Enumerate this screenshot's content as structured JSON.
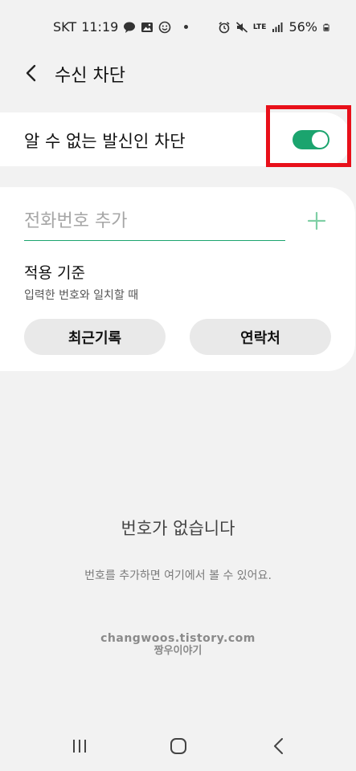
{
  "status_bar": {
    "carrier": "SKT",
    "time": "11:19",
    "network": "LTE",
    "battery": "56%"
  },
  "header": {
    "title": "수신 차단"
  },
  "master_switch": {
    "label": "알 수 없는 발신인 차단",
    "on": true
  },
  "add_number": {
    "placeholder": "전화번호 추가",
    "criteria_title": "적용 기준",
    "criteria_value": "입력한 번호와 일치할 때",
    "recent_button": "최근기록",
    "contacts_button": "연락처"
  },
  "empty_state": {
    "title": "번호가 없습니다",
    "subtitle": "번호를 추가하면 여기에서 볼 수 있어요."
  },
  "watermark": {
    "line1": "changwoos.tistory.com",
    "line2": "짱우이야기"
  },
  "colors": {
    "accent": "#1ba46e",
    "highlight_box": "#e8101a",
    "background": "#f2f2f2"
  }
}
